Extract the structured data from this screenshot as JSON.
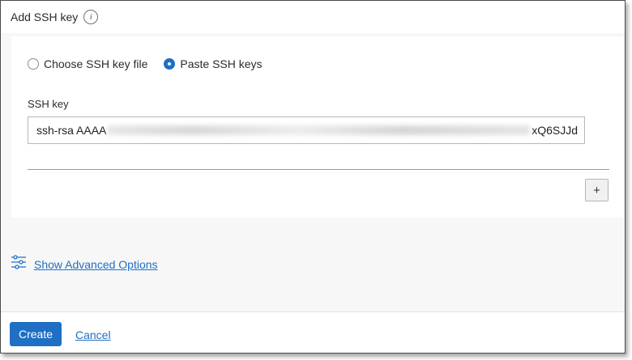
{
  "header": {
    "title": "Add SSH key",
    "info_glyph": "i"
  },
  "key_source": {
    "options": [
      {
        "label": "Choose SSH key file",
        "selected": false
      },
      {
        "label": "Paste SSH keys",
        "selected": true
      }
    ]
  },
  "ssh_key": {
    "label": "SSH key",
    "value_start": "ssh-rsa AAAA",
    "value_end": "xQ6SJJd"
  },
  "add_button": {
    "label": "+"
  },
  "advanced": {
    "icon": "sliders-icon",
    "link_label": "Show Advanced Options"
  },
  "footer": {
    "create_label": "Create",
    "cancel_label": "Cancel"
  },
  "colors": {
    "accent": "#1f6fc5",
    "panel_bg": "#f7f7f7",
    "card_bg": "#ffffff"
  }
}
